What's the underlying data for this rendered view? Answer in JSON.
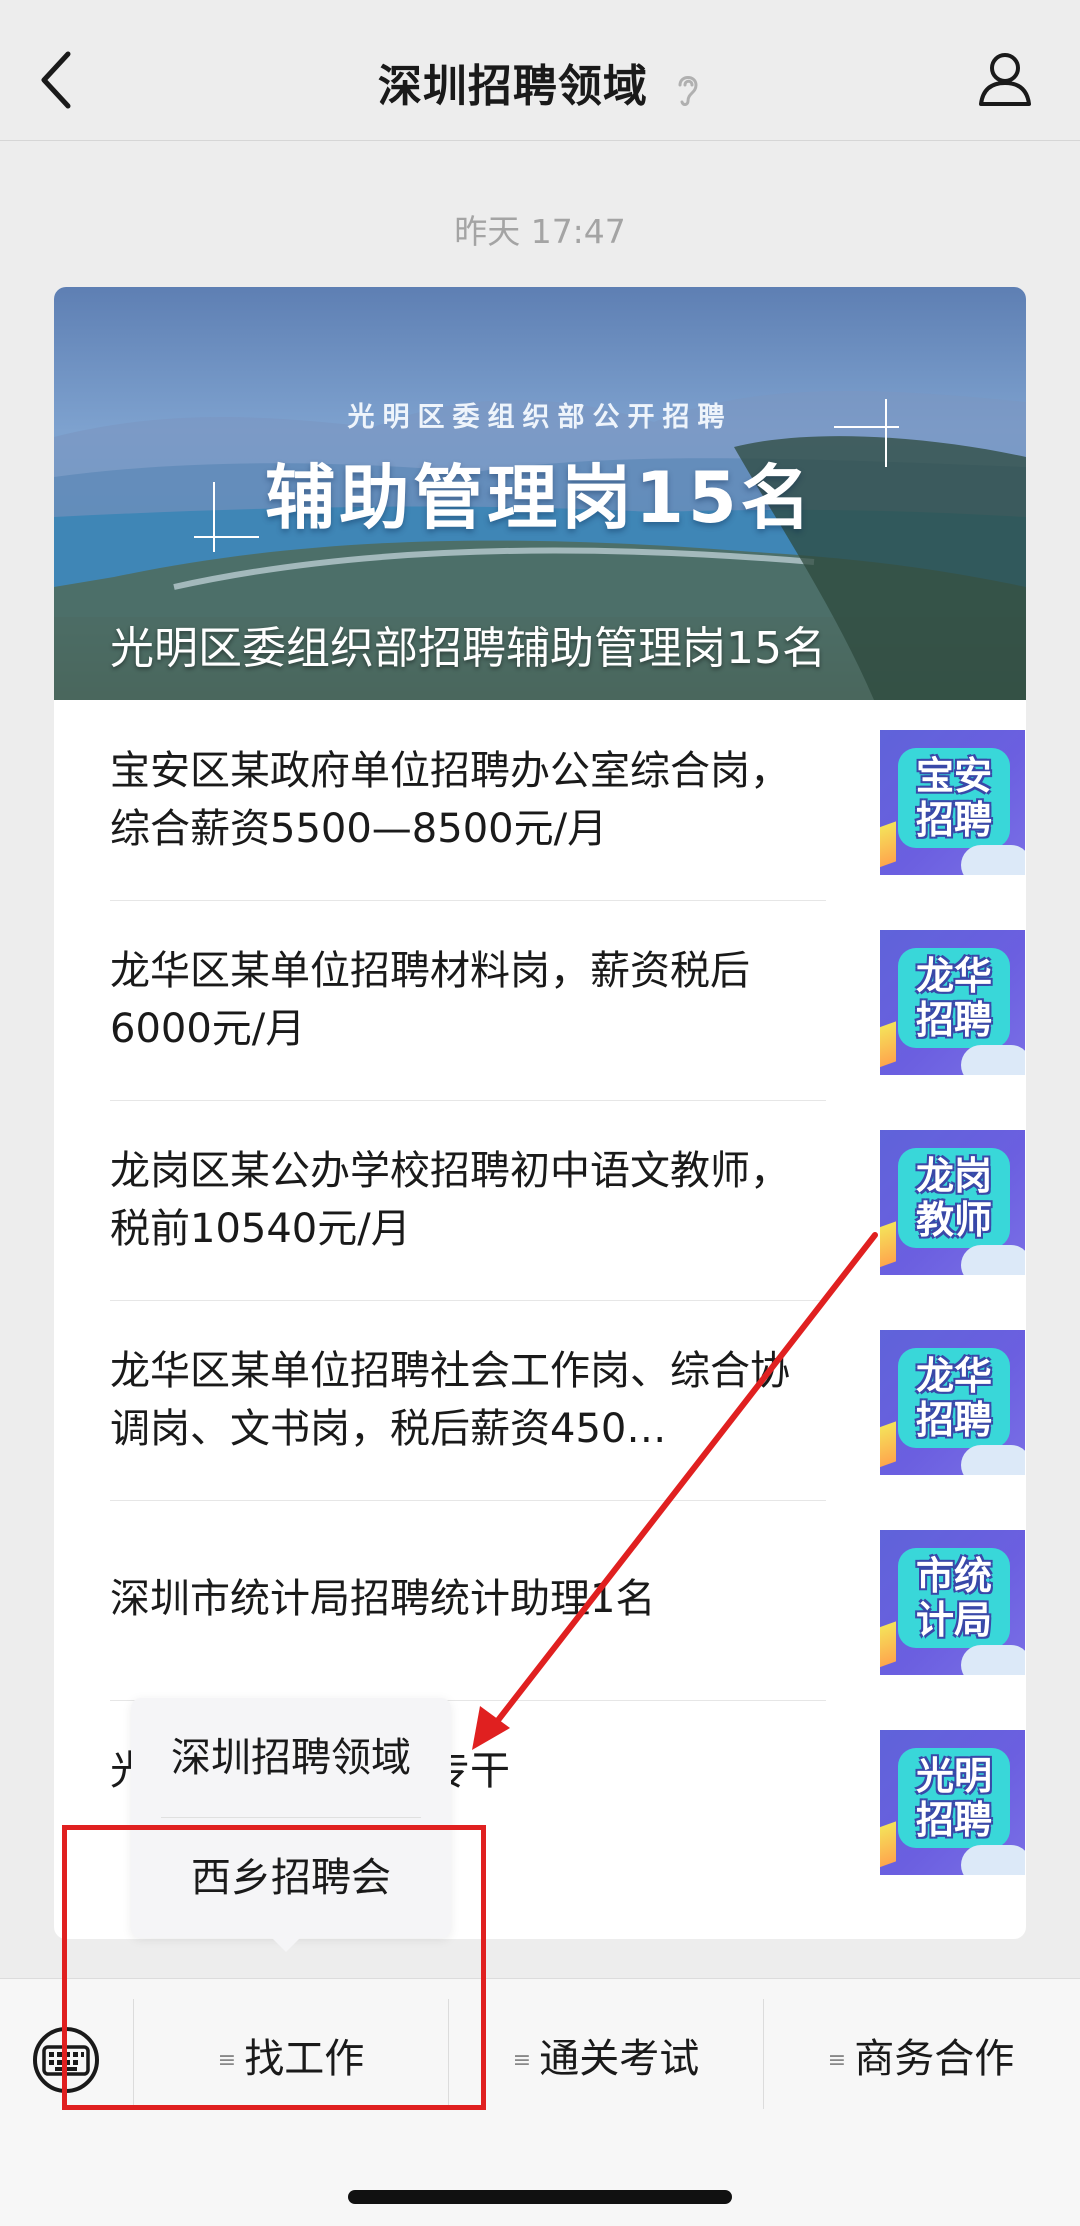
{
  "header": {
    "title": "深圳招聘领域"
  },
  "timestamp": "昨天 17:47",
  "banner": {
    "subtitle": "光明区委组织部公开招聘",
    "headline": "辅助管理岗15名",
    "caption": "光明区委组织部招聘辅助管理岗15名"
  },
  "articles": [
    {
      "title": "宝安区某政府单位招聘办公室综合岗，综合薪资5500—8500元/月",
      "thumb": "宝安\n招聘"
    },
    {
      "title": "龙华区某单位招聘材料岗，薪资税后6000元/月",
      "thumb": "龙华\n招聘"
    },
    {
      "title": "龙岗区某公办学校招聘初中语文教师，税前10540元/月",
      "thumb": "龙岗\n教师"
    },
    {
      "title": "龙华区某单位招聘社会工作岗、综合协调岗、文书岗，税后薪资450…",
      "thumb": "龙华\n招聘"
    },
    {
      "title": "深圳市统计局招聘统计助理1名",
      "thumb": "市统\n计局"
    },
    {
      "title": "光……一般类岗位专干",
      "thumb": "光明\n招聘"
    }
  ],
  "popup_menu": {
    "items": [
      "深圳招聘领域",
      "西乡招聘会"
    ]
  },
  "bottom_menu": {
    "tabs": [
      "找工作",
      "通关考试",
      "商务合作"
    ]
  },
  "colors": {
    "annotation": "#e02020",
    "thumb_bg": "#5f63d9",
    "thumb_bubble": "#39d7d9"
  }
}
